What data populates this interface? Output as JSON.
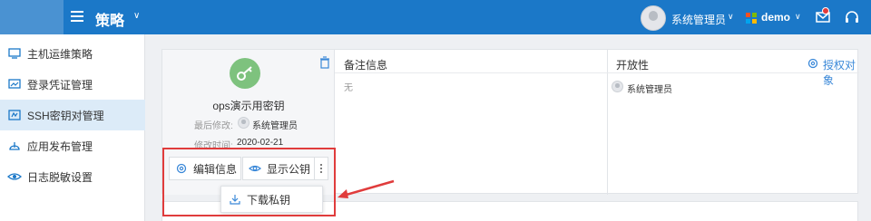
{
  "header": {
    "title": "策略",
    "user_name": "系统管理员",
    "tenant": "demo",
    "colors": {
      "bar": "#1b78c8",
      "accent": "#3a88d8"
    },
    "icons": [
      "menu-icon",
      "user-avatar",
      "microsoft-logo",
      "mail-icon",
      "headset-icon"
    ]
  },
  "sidebar": {
    "items": [
      {
        "label": "主机运维策略",
        "icon": "host-policy-icon"
      },
      {
        "label": "登录凭证管理",
        "icon": "credential-icon"
      },
      {
        "label": "SSH密钥对管理",
        "icon": "ssh-key-icon",
        "active": true
      },
      {
        "label": "应用发布管理",
        "icon": "app-publish-icon"
      },
      {
        "label": "日志脱敏设置",
        "icon": "eye-icon"
      }
    ]
  },
  "key_card": {
    "name": "ops演示用密钥",
    "modified_by_label": "最后修改:",
    "modified_by": "系统管理员",
    "modified_time_label": "修改时间:",
    "modified_time": "2020-02-21",
    "edit_label": "编辑信息",
    "show_key_label": "显示公钥",
    "notes_header": "备注信息",
    "notes_value": "无",
    "openness_header": "开放性",
    "open_user": "系统管理员",
    "authorize_label": "授权对象"
  },
  "dropdown": {
    "download_label": "下载私钥"
  }
}
